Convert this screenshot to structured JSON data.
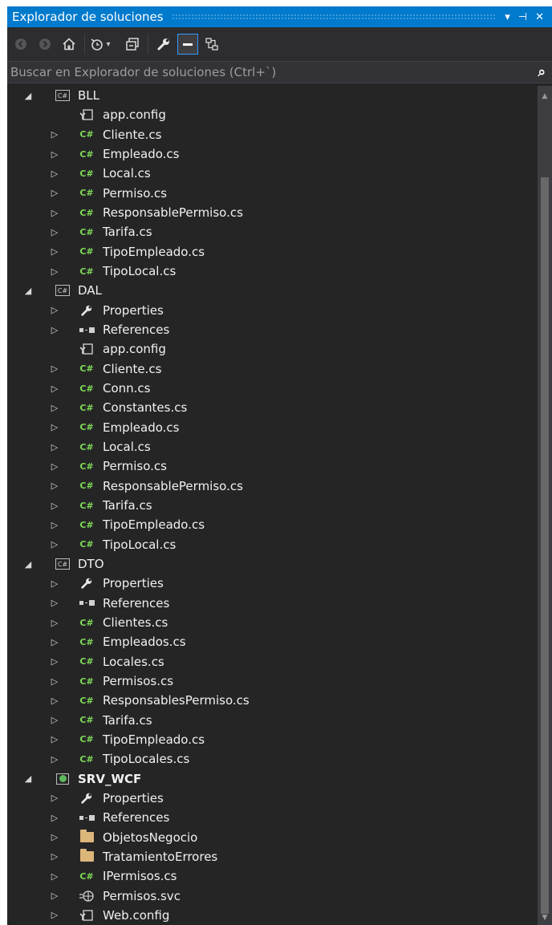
{
  "window": {
    "title": "Explorador de soluciones",
    "dropdown_glyph": "▾",
    "pin_glyph": "⊣",
    "close_glyph": "✕"
  },
  "toolbar": {
    "buttons": [
      {
        "name": "back",
        "icon": "circle-left-icon"
      },
      {
        "name": "forward",
        "icon": "circle-right-icon"
      },
      {
        "name": "home",
        "icon": "home-icon"
      },
      {
        "name": "pending-changes-filter",
        "icon": "clock-icon"
      },
      {
        "name": "collapse-all",
        "icon": "collapse-icon"
      },
      {
        "name": "properties",
        "icon": "wrench-icon"
      },
      {
        "name": "preview-selected-items",
        "icon": "dash-icon",
        "active": true
      },
      {
        "name": "view-class-diagram",
        "icon": "class-diagram-icon"
      }
    ]
  },
  "search": {
    "placeholder": "Buscar en Explorador de soluciones (Ctrl+`)"
  },
  "tree": {
    "rows": [
      {
        "level": 0,
        "label": "BLL",
        "icon": "csharp-project-icon",
        "arrow": "expanded"
      },
      {
        "level": 1,
        "label": "app.config",
        "icon": "config-icon",
        "arrow": "none"
      },
      {
        "level": 1,
        "label": "Cliente.cs",
        "icon": "csharp-file-icon",
        "arrow": "collapsed"
      },
      {
        "level": 1,
        "label": "Empleado.cs",
        "icon": "csharp-file-icon",
        "arrow": "collapsed"
      },
      {
        "level": 1,
        "label": "Local.cs",
        "icon": "csharp-file-icon",
        "arrow": "collapsed"
      },
      {
        "level": 1,
        "label": "Permiso.cs",
        "icon": "csharp-file-icon",
        "arrow": "collapsed"
      },
      {
        "level": 1,
        "label": "ResponsablePermiso.cs",
        "icon": "csharp-file-icon",
        "arrow": "collapsed"
      },
      {
        "level": 1,
        "label": "Tarifa.cs",
        "icon": "csharp-file-icon",
        "arrow": "collapsed"
      },
      {
        "level": 1,
        "label": "TipoEmpleado.cs",
        "icon": "csharp-file-icon",
        "arrow": "collapsed"
      },
      {
        "level": 1,
        "label": "TipoLocal.cs",
        "icon": "csharp-file-icon",
        "arrow": "collapsed"
      },
      {
        "level": 0,
        "label": "DAL",
        "icon": "csharp-project-icon",
        "arrow": "expanded"
      },
      {
        "level": 1,
        "label": "Properties",
        "icon": "wrench-icon",
        "arrow": "collapsed"
      },
      {
        "level": 1,
        "label": "References",
        "icon": "references-icon",
        "arrow": "collapsed"
      },
      {
        "level": 1,
        "label": "app.config",
        "icon": "config-icon",
        "arrow": "none"
      },
      {
        "level": 1,
        "label": "Cliente.cs",
        "icon": "csharp-file-icon",
        "arrow": "collapsed"
      },
      {
        "level": 1,
        "label": "Conn.cs",
        "icon": "csharp-file-icon",
        "arrow": "collapsed"
      },
      {
        "level": 1,
        "label": "Constantes.cs",
        "icon": "csharp-file-icon",
        "arrow": "collapsed"
      },
      {
        "level": 1,
        "label": "Empleado.cs",
        "icon": "csharp-file-icon",
        "arrow": "collapsed"
      },
      {
        "level": 1,
        "label": "Local.cs",
        "icon": "csharp-file-icon",
        "arrow": "collapsed"
      },
      {
        "level": 1,
        "label": "Permiso.cs",
        "icon": "csharp-file-icon",
        "arrow": "collapsed"
      },
      {
        "level": 1,
        "label": "ResponsablePermiso.cs",
        "icon": "csharp-file-icon",
        "arrow": "collapsed"
      },
      {
        "level": 1,
        "label": "Tarifa.cs",
        "icon": "csharp-file-icon",
        "arrow": "collapsed"
      },
      {
        "level": 1,
        "label": "TipoEmpleado.cs",
        "icon": "csharp-file-icon",
        "arrow": "collapsed"
      },
      {
        "level": 1,
        "label": "TipoLocal.cs",
        "icon": "csharp-file-icon",
        "arrow": "collapsed"
      },
      {
        "level": 0,
        "label": "DTO",
        "icon": "csharp-project-icon",
        "arrow": "expanded"
      },
      {
        "level": 1,
        "label": "Properties",
        "icon": "wrench-icon",
        "arrow": "collapsed"
      },
      {
        "level": 1,
        "label": "References",
        "icon": "references-icon",
        "arrow": "collapsed"
      },
      {
        "level": 1,
        "label": "Clientes.cs",
        "icon": "csharp-file-icon",
        "arrow": "collapsed"
      },
      {
        "level": 1,
        "label": "Empleados.cs",
        "icon": "csharp-file-icon",
        "arrow": "collapsed"
      },
      {
        "level": 1,
        "label": "Locales.cs",
        "icon": "csharp-file-icon",
        "arrow": "collapsed"
      },
      {
        "level": 1,
        "label": "Permisos.cs",
        "icon": "csharp-file-icon",
        "arrow": "collapsed"
      },
      {
        "level": 1,
        "label": "ResponsablesPermiso.cs",
        "icon": "csharp-file-icon",
        "arrow": "collapsed"
      },
      {
        "level": 1,
        "label": "Tarifa.cs",
        "icon": "csharp-file-icon",
        "arrow": "collapsed"
      },
      {
        "level": 1,
        "label": "TipoEmpleado.cs",
        "icon": "csharp-file-icon",
        "arrow": "collapsed"
      },
      {
        "level": 1,
        "label": "TipoLocales.cs",
        "icon": "csharp-file-icon",
        "arrow": "collapsed"
      },
      {
        "level": 0,
        "label": "SRV_WCF",
        "icon": "web-project-icon",
        "arrow": "expanded",
        "bold": true
      },
      {
        "level": 1,
        "label": "Properties",
        "icon": "wrench-icon",
        "arrow": "collapsed"
      },
      {
        "level": 1,
        "label": "References",
        "icon": "references-icon",
        "arrow": "collapsed"
      },
      {
        "level": 1,
        "label": "ObjetosNegocio",
        "icon": "folder-icon",
        "arrow": "collapsed"
      },
      {
        "level": 1,
        "label": "TratamientoErrores",
        "icon": "folder-icon",
        "arrow": "collapsed"
      },
      {
        "level": 1,
        "label": "IPermisos.cs",
        "icon": "csharp-file-icon",
        "arrow": "collapsed"
      },
      {
        "level": 1,
        "label": "Permisos.svc",
        "icon": "svc-file-icon",
        "arrow": "collapsed"
      },
      {
        "level": 1,
        "label": "Web.config",
        "icon": "config-icon",
        "arrow": "collapsed"
      }
    ]
  },
  "colors": {
    "accent": "#007acc",
    "background": "#252526",
    "csharp_icon": "#7ed957",
    "folder_icon": "#dcb67a"
  }
}
